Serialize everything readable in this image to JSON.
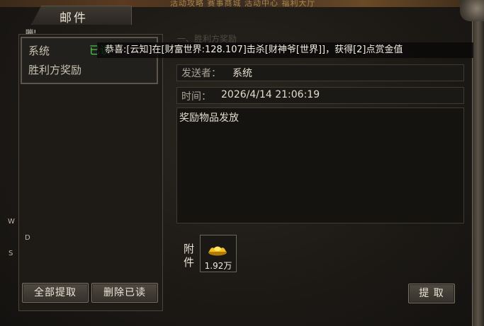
{
  "window": {
    "title": "邮件",
    "top_banner": "活动攻略   赛事商城   活动中心   福利大厅"
  },
  "top_left_label": "嘣!",
  "mail_list": [
    {
      "label": "系统"
    },
    {
      "label": "胜利方奖励"
    }
  ],
  "read_tag": "已读",
  "side_letters": [
    "W",
    "D",
    "S"
  ],
  "buttons": {
    "take_all": "全部提取",
    "delete_read": "删除已读",
    "take": "提 取"
  },
  "detail": {
    "faded_header": "一、胜利方奖励",
    "sender_label": "发送者：",
    "sender_value": "系统",
    "time_label": "时间：",
    "time_value": "2026/4/14 21:06:19",
    "body": "奖励物品发放"
  },
  "attachment": {
    "label_line1": "附",
    "label_line2": "件",
    "item_icon": "gold-ingot-icon",
    "count": "1.92万"
  },
  "broadcast": "恭喜:[云知]在[财富世界:128.107]击杀[财神爷[世界]]，获得[2]点赏金值"
}
